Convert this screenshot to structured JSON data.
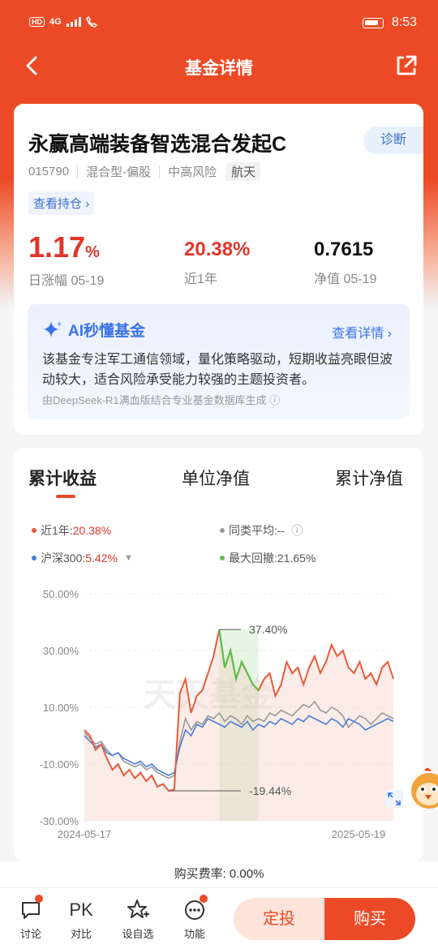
{
  "status": {
    "time": "8:53",
    "network": "4G",
    "hd": "HD"
  },
  "header": {
    "title": "基金详情"
  },
  "fund": {
    "name": "永赢高端装备智选混合发起C",
    "diagnose_label": "诊断",
    "code": "015790",
    "type": "混合型-偏股",
    "risk": "中高风险",
    "theme": "航天",
    "holdings_label": "查看持仓"
  },
  "stats": {
    "daily_change_value": "1.17",
    "daily_change_unit": "%",
    "daily_change_label": "日涨幅 05-19",
    "year_return_value": "20.38%",
    "year_return_label": "近1年",
    "nav_value": "0.7615",
    "nav_label": "净值 05-19"
  },
  "ai": {
    "title": "AI秒懂基金",
    "more_label": "查看详情",
    "text": "该基金专注军工通信领域，量化策略驱动，短期收益亮眼但波动较大，适合风险承受能力较强的主题投资者。",
    "source": "由DeepSeek-R1满血版结合专业基金数据库生成"
  },
  "chart_tabs": [
    "累计收益",
    "单位净值",
    "累计净值"
  ],
  "legend": {
    "fund_label": "近1年:",
    "fund_value": "20.38%",
    "peer_label": "同类平均:",
    "peer_value": "--",
    "index_label": "沪深300:",
    "index_value": "5.42%",
    "drawdown_label": "最大回撤:",
    "drawdown_value": "21.65%"
  },
  "chart_data": {
    "type": "line",
    "y_ticks": [
      "50.00%",
      "30.00%",
      "10.00%",
      "-10.00%",
      "-30.00%"
    ],
    "ylim": [
      -30,
      50
    ],
    "x_start": "2024-05-17",
    "x_end": "2025-05-19",
    "annotations": {
      "max": "37.40%",
      "min": "-19.44%"
    },
    "watermark": "天天基金",
    "colors": {
      "fund": "#e85a3a",
      "index": "#4a7fd6",
      "peer": "#999999",
      "drawdown": "#5cbf4a"
    },
    "series": [
      {
        "name": "近1年",
        "values": [
          2,
          0,
          -5,
          -3,
          -8,
          -12,
          -10,
          -14,
          -12,
          -15,
          -13,
          -16,
          -14,
          -18,
          -17,
          -19.44,
          -19,
          15,
          20,
          8,
          14,
          16,
          22,
          28,
          37.4,
          24,
          30,
          20,
          26,
          22,
          18,
          16,
          20,
          22,
          14,
          18,
          26,
          22,
          24,
          18,
          24,
          28,
          22,
          26,
          32,
          28,
          30,
          24,
          22,
          26,
          20,
          22,
          18,
          24,
          26,
          20
        ]
      },
      {
        "name": "沪深300",
        "values": [
          0,
          -2,
          -4,
          -3,
          -6,
          -7,
          -6,
          -8,
          -9,
          -10,
          -9,
          -11,
          -10,
          -12,
          -13,
          -14,
          -13,
          -4,
          2,
          0,
          4,
          3,
          6,
          5,
          4,
          3,
          5,
          4,
          3,
          5,
          2,
          4,
          3,
          5,
          4,
          6,
          5,
          4,
          6,
          5,
          7,
          6,
          5,
          4,
          6,
          5,
          3,
          6,
          5,
          4,
          2,
          3,
          4,
          5,
          6,
          5
        ]
      },
      {
        "name": "同类平均",
        "values": [
          1,
          -1,
          -3,
          -2,
          -5,
          -7,
          -6,
          -9,
          -10,
          -11,
          -10,
          -12,
          -11,
          -13,
          -14,
          -15,
          -14,
          -2,
          6,
          2,
          5,
          4,
          7,
          6,
          8,
          5,
          7,
          6,
          4,
          7,
          5,
          6,
          5,
          8,
          7,
          9,
          8,
          7,
          9,
          11,
          10,
          12,
          9,
          8,
          10,
          9,
          7,
          3,
          5,
          7,
          6,
          4,
          6,
          8,
          7,
          6
        ]
      }
    ]
  },
  "fee": {
    "text": "购买费率: 0.00%"
  },
  "bottom": {
    "discuss": "讨论",
    "compare_icon": "PK",
    "compare": "对比",
    "watchlist": "设自选",
    "functions": "功能",
    "auto_invest": "定投",
    "buy": "购买"
  }
}
